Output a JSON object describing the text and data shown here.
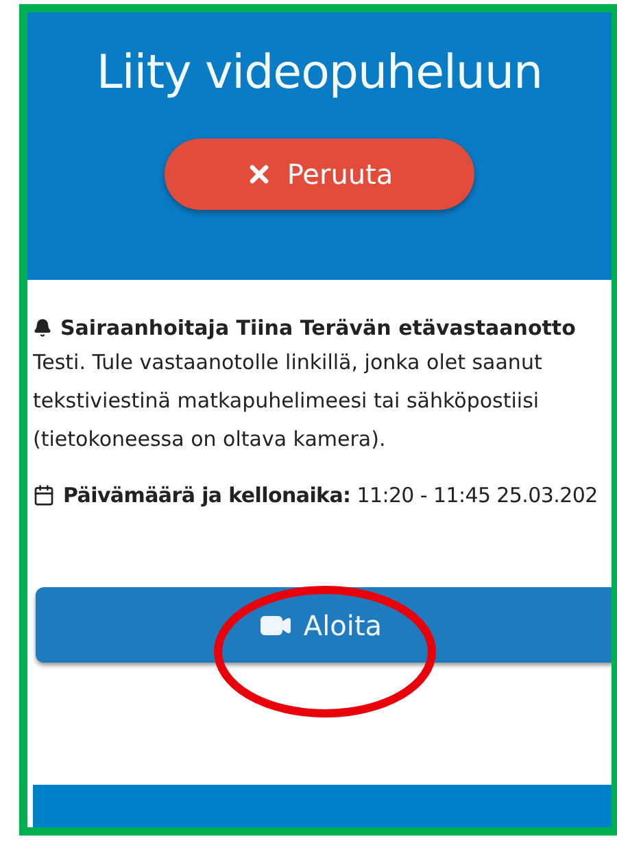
{
  "header": {
    "title": "Liity videopuheluun",
    "cancel_button": "Peruuta"
  },
  "appointment": {
    "title": "Sairaanhoitaja Tiina Terävän etävastaanotto",
    "description": "Testi. Tule vastaanotolle linkillä, jonka olet saanut tekstiviestinä matkapuhelimeesi tai sähköpostiisi (tietokoneessa on oltava kamera).",
    "date_line": "**Päivämäärä ja kellonaika:** 11:20 - 11:45 25.03.202"
  },
  "start_button": "Aloita"
}
